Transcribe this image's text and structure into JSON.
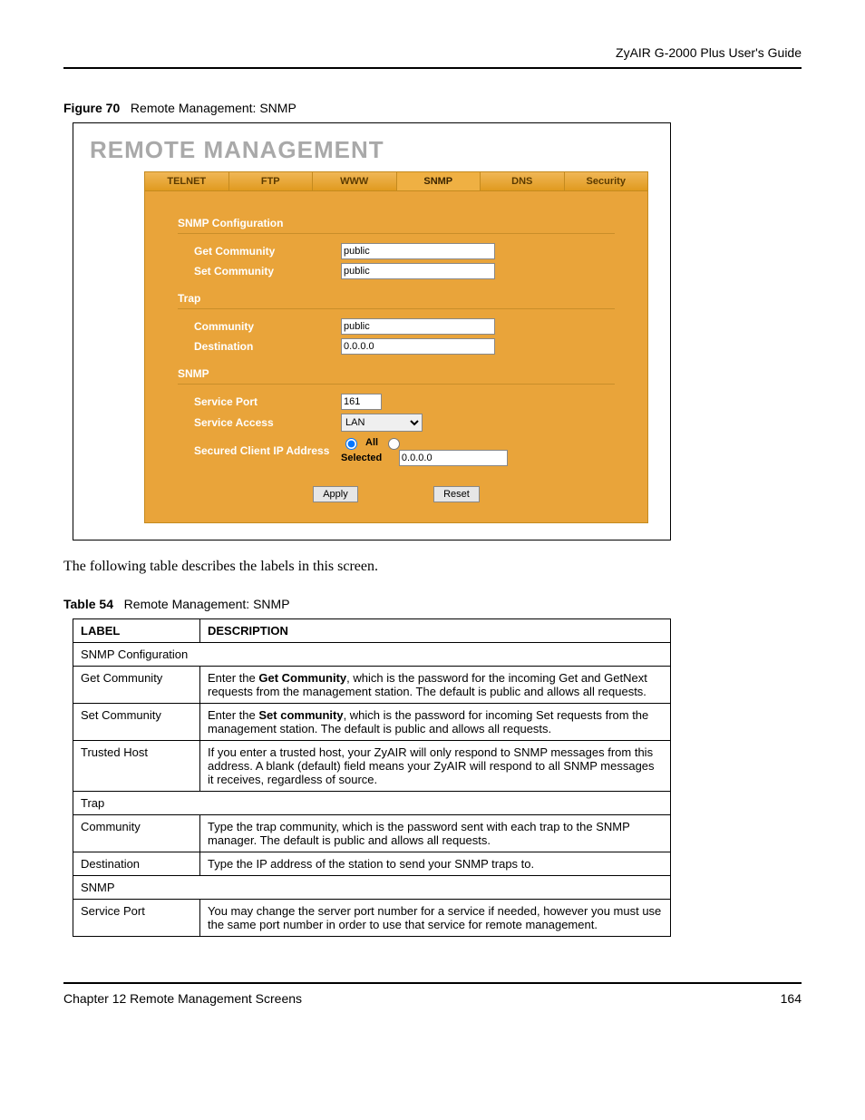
{
  "header": {
    "guide_title": "ZyAIR G-2000 Plus User's Guide"
  },
  "figure": {
    "label": "Figure 70",
    "caption": "Remote Management: SNMP"
  },
  "screenshot": {
    "title": "REMOTE MANAGEMENT",
    "tabs": [
      "TELNET",
      "FTP",
      "WWW",
      "SNMP",
      "DNS",
      "Security"
    ],
    "active_tab_index": 3,
    "sections": {
      "snmp_config": {
        "title": "SNMP Configuration",
        "get_community_label": "Get Community",
        "get_community_value": "public",
        "set_community_label": "Set Community",
        "set_community_value": "public"
      },
      "trap": {
        "title": "Trap",
        "community_label": "Community",
        "community_value": "public",
        "destination_label": "Destination",
        "destination_value": "0.0.0.0"
      },
      "snmp": {
        "title": "SNMP",
        "service_port_label": "Service Port",
        "service_port_value": "161",
        "service_access_label": "Service Access",
        "service_access_value": "LAN",
        "secured_ip_label": "Secured Client IP Address",
        "radio_all": "All",
        "radio_selected": "Selected",
        "selected_ip_value": "0.0.0.0"
      }
    },
    "buttons": {
      "apply": "Apply",
      "reset": "Reset"
    }
  },
  "body_text": "The following table describes the labels in this screen.",
  "table": {
    "label": "Table 54",
    "caption": "Remote Management: SNMP",
    "header_label": "LABEL",
    "header_desc": "DESCRIPTION",
    "rows": [
      {
        "span": true,
        "label": "SNMP Configuration"
      },
      {
        "label": "Get Community",
        "desc_prefix": "Enter the ",
        "desc_bold": "Get Community",
        "desc_suffix": ", which is the password for the incoming Get and GetNext requests from the management station. The default is public and allows all requests."
      },
      {
        "label": "Set Community",
        "desc_prefix": "Enter the ",
        "desc_bold": "Set community",
        "desc_suffix": ", which is the password for incoming Set requests from the management station. The default is public and allows all requests."
      },
      {
        "label": "Trusted Host",
        "desc": "If you enter a trusted host, your ZyAIR will only respond to SNMP messages from this address. A blank (default) field means your ZyAIR will respond to all SNMP messages it receives, regardless of source."
      },
      {
        "span": true,
        "label": "Trap"
      },
      {
        "label": "Community",
        "desc": "Type the trap community, which is the password sent with each trap to the SNMP manager. The default is public and allows all requests."
      },
      {
        "label": "Destination",
        "desc": "Type the IP address of the station to send your SNMP traps to."
      },
      {
        "span": true,
        "label": "SNMP"
      },
      {
        "label": "Service Port",
        "desc": "You may change the server port number for a service if needed, however you must use the same port number in order to use that service for remote management."
      }
    ]
  },
  "footer": {
    "chapter": "Chapter 12 Remote Management Screens",
    "page": "164"
  }
}
